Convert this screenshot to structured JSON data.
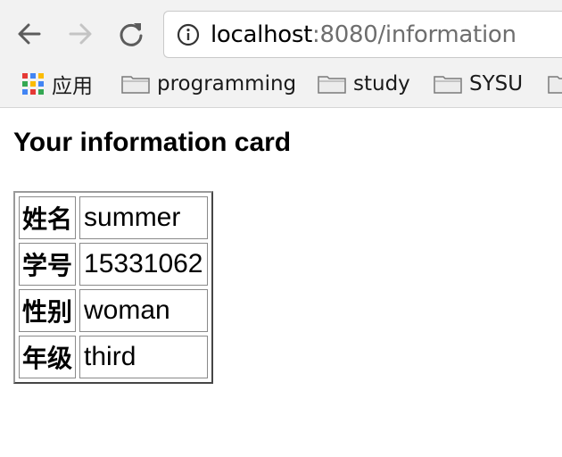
{
  "browser": {
    "url_host": "localhost",
    "url_rest": ":8080/information"
  },
  "bookmarks": [
    {
      "label": "应用",
      "icon": "apps-grid-icon"
    },
    {
      "label": "programming",
      "icon": "folder-icon"
    },
    {
      "label": "study",
      "icon": "folder-icon"
    },
    {
      "label": "SYSU",
      "icon": "folder-icon"
    }
  ],
  "page": {
    "title": "Your information card",
    "rows": [
      {
        "key": "姓名",
        "value": "summer"
      },
      {
        "key": "学号",
        "value": "15331062"
      },
      {
        "key": "性别",
        "value": "woman"
      },
      {
        "key": "年级",
        "value": "third"
      }
    ]
  },
  "colors": {
    "toolbar_bg": "#f2f2f2",
    "url_host": "#000000",
    "url_path": "#6e6e6e"
  }
}
